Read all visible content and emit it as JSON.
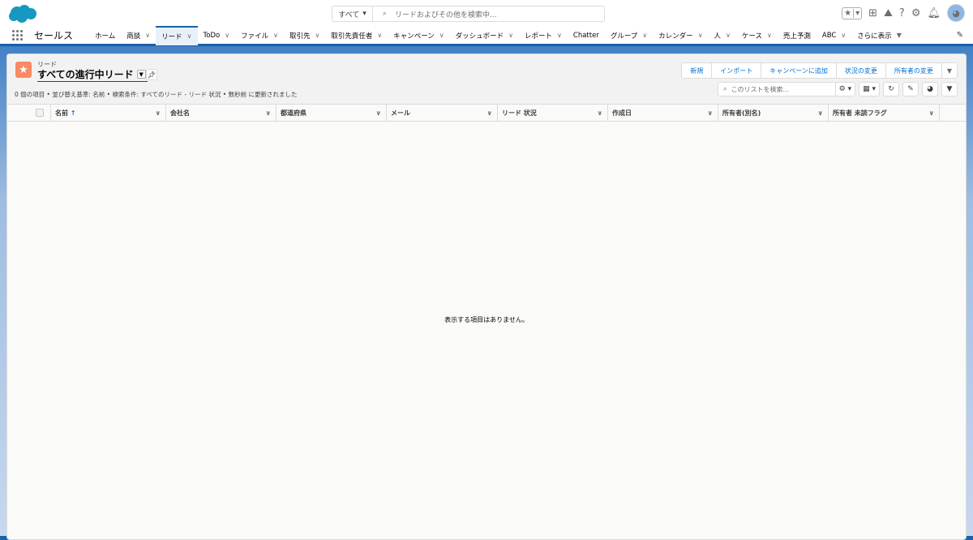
{
  "header": {
    "search_scope": "すべて",
    "search_placeholder": "リードおよびその他を検索中..."
  },
  "nav": {
    "app_name": "セールス",
    "items": [
      {
        "label": "ホーム",
        "menu": false
      },
      {
        "label": "商談",
        "menu": true
      },
      {
        "label": "リード",
        "menu": true,
        "active": true
      },
      {
        "label": "ToDo",
        "menu": true
      },
      {
        "label": "ファイル",
        "menu": true
      },
      {
        "label": "取引先",
        "menu": true
      },
      {
        "label": "取引先責任者",
        "menu": true
      },
      {
        "label": "キャンペーン",
        "menu": true
      },
      {
        "label": "ダッシュボード",
        "menu": true
      },
      {
        "label": "レポート",
        "menu": true
      },
      {
        "label": "Chatter",
        "menu": false
      },
      {
        "label": "グループ",
        "menu": true
      },
      {
        "label": "カレンダー",
        "menu": true
      },
      {
        "label": "人",
        "menu": true
      },
      {
        "label": "ケース",
        "menu": true
      },
      {
        "label": "売上予測",
        "menu": false
      },
      {
        "label": "ABC",
        "menu": true
      }
    ],
    "more": "さらに表示"
  },
  "list": {
    "object": "リード",
    "view": "すべての進行中リード",
    "meta": "0 個の項目 • 並び替え基準: 名前 • 検索条件: すべてのリード - リード 状況 • 数秒前 に更新されました",
    "actions": [
      "新規",
      "インポート",
      "キャンペーンに追加",
      "状況の変更",
      "所有者の変更"
    ],
    "search_placeholder": "このリストを検索...",
    "columns": [
      "名前",
      "会社名",
      "都道府県",
      "メール",
      "リード 状況",
      "作成日",
      "所有者(別名)",
      "所有者 未読フラグ"
    ],
    "sort_indicator": "↑",
    "empty": "表示する項目はありません。"
  }
}
